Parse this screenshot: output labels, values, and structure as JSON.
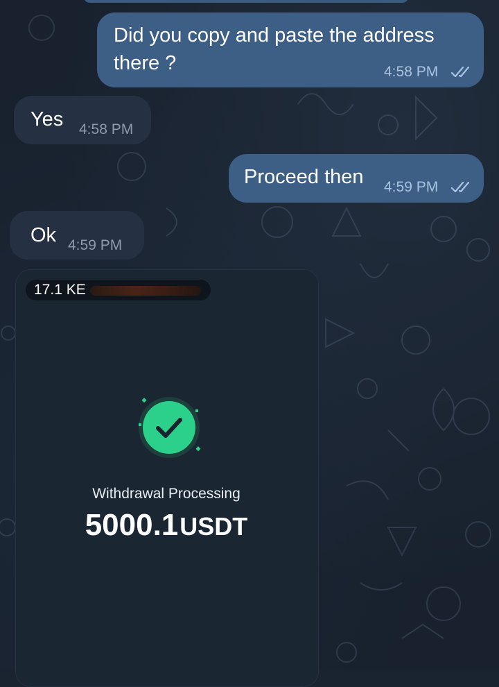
{
  "messages": [
    {
      "id": "m1",
      "direction": "outgoing",
      "lines": [
        "Did you copy and paste the address",
        "there ?"
      ],
      "time": "4:58 PM",
      "status": "read"
    },
    {
      "id": "m2",
      "direction": "incoming",
      "text": "Yes",
      "time": "4:58 PM"
    },
    {
      "id": "m3",
      "direction": "outgoing",
      "text": "Proceed then",
      "time": "4:59 PM",
      "status": "read"
    },
    {
      "id": "m4",
      "direction": "incoming",
      "text": "Ok",
      "time": "4:59 PM"
    }
  ],
  "image_message": {
    "file_size": "17.1 KE",
    "redacted_name": true,
    "status_icon": "check-circle-icon",
    "title": "Withdrawal Processing",
    "amount": "5000.1",
    "unit": "USDT"
  },
  "colors": {
    "background": "#18212d",
    "outgoing_bubble": "#3d5e85",
    "incoming_bubble": "#253142",
    "success_green": "#2bd18a"
  }
}
